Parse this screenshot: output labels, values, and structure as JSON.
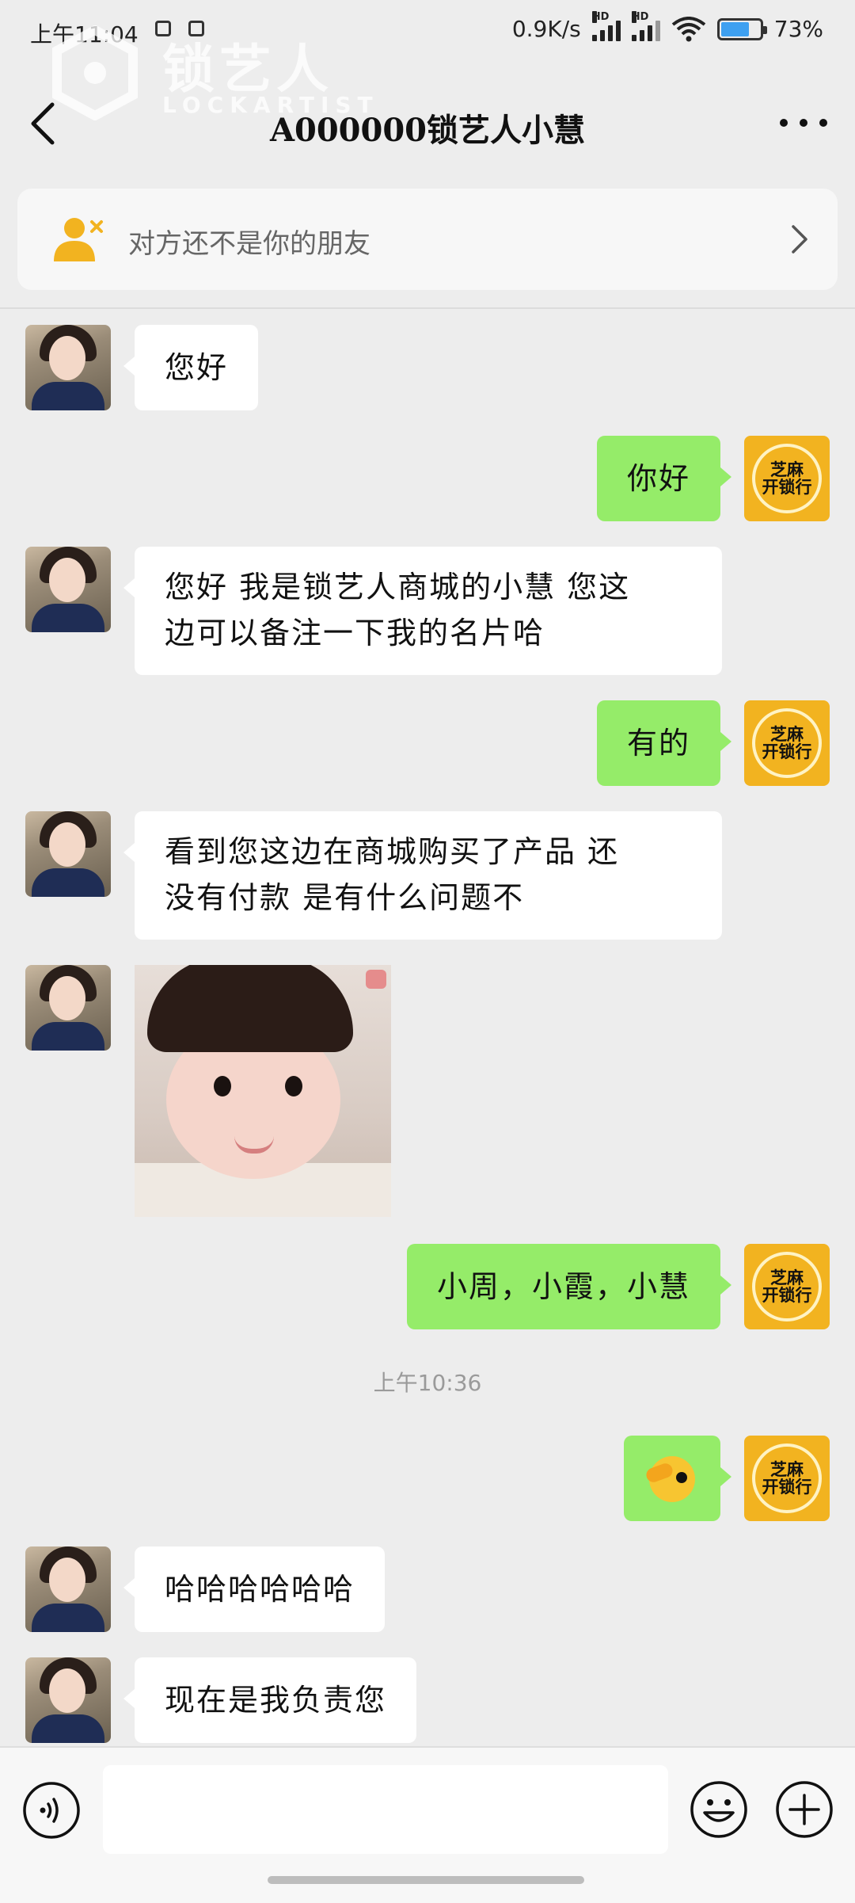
{
  "status_bar": {
    "time": "上午11:04",
    "network_speed": "0.9K/s",
    "signal_label_1": "HD",
    "signal_label_2": "HD",
    "battery_percent": "73%",
    "battery_level": 0.73
  },
  "watermark": {
    "brand_cn": "锁艺人",
    "brand_en": "LOCKARTIST"
  },
  "header": {
    "title": "A000000锁艺人小慧",
    "back_icon": "chevron-left-icon",
    "more_icon": "more-dots-icon"
  },
  "notice": {
    "text": "对方还不是你的朋友",
    "icon": "add-user-icon",
    "arrow_icon": "chevron-right-icon"
  },
  "shop_avatar": {
    "line1": "芝麻",
    "line2": "开锁行"
  },
  "messages": [
    {
      "side": "left",
      "type": "text",
      "text": "您好"
    },
    {
      "side": "right",
      "type": "text",
      "text": "你好"
    },
    {
      "side": "left",
      "type": "text",
      "line1": "您好 我是锁艺人商城的小慧 您这",
      "line2": "边可以备注一下我的名片哈"
    },
    {
      "side": "right",
      "type": "text",
      "text": "有的"
    },
    {
      "side": "left",
      "type": "text",
      "line1": "看到您这边在商城购买了产品 还",
      "line2": "没有付款 是有什么问题不"
    },
    {
      "side": "left",
      "type": "image",
      "image": "baby-sticker"
    },
    {
      "side": "right",
      "type": "text",
      "text": "小周，小霞，小慧"
    },
    {
      "side": "right",
      "type": "emoji",
      "emoji": "wink-emoji"
    },
    {
      "side": "left",
      "type": "text",
      "text": "哈哈哈哈哈哈"
    },
    {
      "side": "left",
      "type": "text",
      "text": "现在是我负责您"
    }
  ],
  "timestamp": "上午10:36",
  "input_bar": {
    "voice_icon": "voice-icon",
    "emoji_icon": "emoji-icon",
    "plus_icon": "plus-icon",
    "placeholder": ""
  },
  "colors": {
    "background": "#ededed",
    "bubble_self": "#95ec69",
    "bubble_other": "#ffffff",
    "shop_avatar": "#f2b320",
    "notice_icon": "#f2b320"
  }
}
